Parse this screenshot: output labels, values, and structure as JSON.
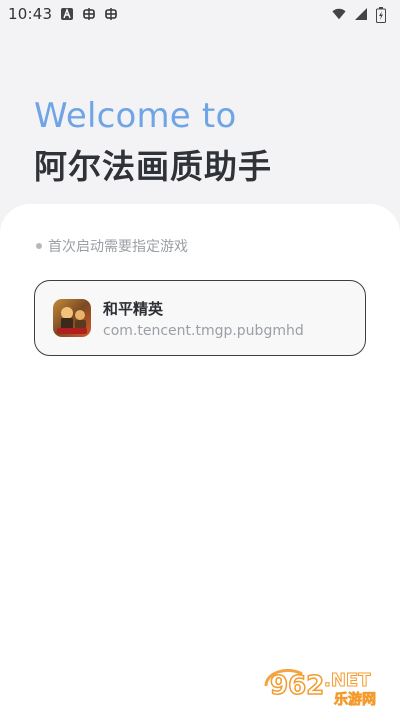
{
  "status_bar": {
    "time": "10:43",
    "left_icons": [
      "a-icon",
      "bug-icon",
      "bug-icon"
    ],
    "right_icons": [
      "wifi-icon",
      "signal-icon",
      "battery-charging-icon"
    ]
  },
  "header": {
    "welcome": "Welcome to",
    "app_title": "阿尔法画质助手"
  },
  "hint": {
    "text": "首次启动需要指定游戏"
  },
  "game": {
    "name": "和平精英",
    "package": "com.tencent.tmgp.pubgmhd",
    "icon": "game-icon"
  },
  "watermark": {
    "big": "962",
    "net": ".NET",
    "sub": "乐游网"
  },
  "colors": {
    "accent_blue": "#6fa5e6",
    "title_dark": "#2f3338",
    "muted_grey": "#9aa0a6",
    "card_border": "#3b3f45",
    "watermark_orange": "#f39b2d"
  }
}
